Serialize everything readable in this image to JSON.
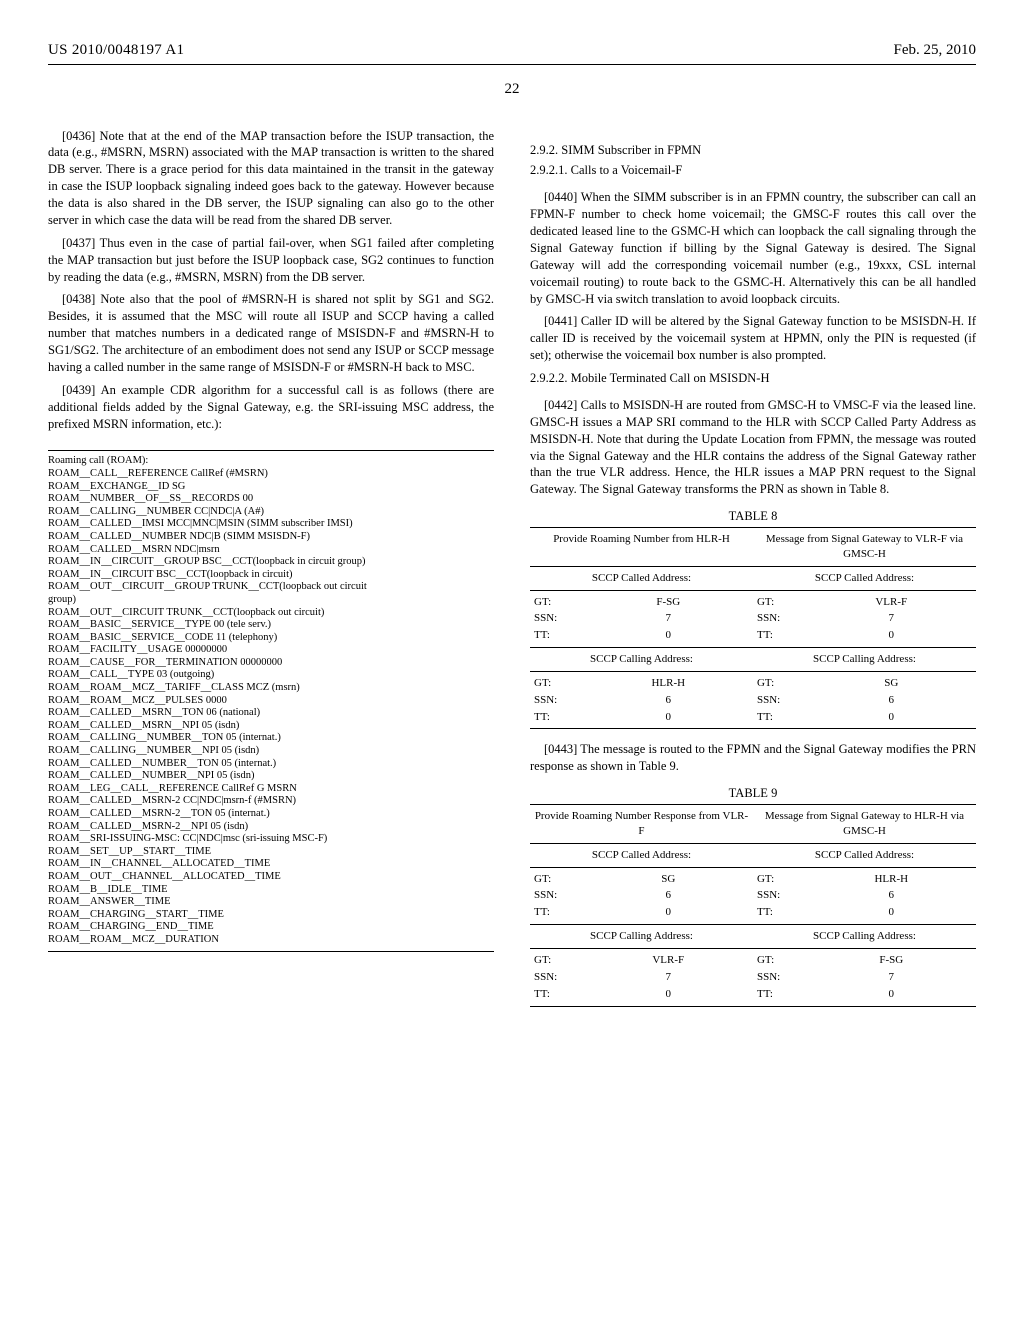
{
  "header": {
    "pubnum": "US 2010/0048197 A1",
    "date": "Feb. 25, 2010",
    "pagenum": "22"
  },
  "left": {
    "p0436": "[0436]   Note that at the end of the MAP transaction before the ISUP transaction, the data (e.g., #MSRN, MSRN) associated with the MAP transaction is written to the shared DB server. There is a grace period for this data maintained in the transit in the gateway in case the ISUP loopback signaling indeed goes back to the gateway. However because the data is also shared in the DB server, the ISUP signaling can also go to the other server in which case the data will be read from the shared DB server.",
    "p0437": "[0437]   Thus even in the case of partial fail-over, when SG1 failed after completing the MAP transaction but just before the ISUP loopback case, SG2 continues to function by reading the data (e.g., #MSRN, MSRN) from the DB server.",
    "p0438": "[0438]   Note also that the pool of #MSRN-H is shared not split by SG1 and SG2. Besides, it is assumed that the MSC will route all ISUP and SCCP having a called number that matches numbers in a dedicated range of MSISDN-F and #MSRN-H to SG1/SG2. The architecture of an embodiment does not send any ISUP or SCCP message having a called number in the same range of MSISDN-F or #MSRN-H back to MSC.",
    "p0439": "[0439]   An example CDR algorithm for a successful call is as follows (there are additional fields added by the Signal Gateway, e.g. the SRI-issuing MSC address, the prefixed MSRN information, etc.):",
    "listing": [
      "Roaming call (ROAM):",
      "ROAM__CALL__REFERENCE CallRef (#MSRN)",
      "ROAM__EXCHANGE__ID SG",
      "ROAM__NUMBER__OF__SS__RECORDS 00",
      "ROAM__CALLING__NUMBER CC|NDC|A (A#)",
      "ROAM__CALLED__IMSI MCC|MNC|MSIN (SIMM subscriber IMSI)",
      "ROAM__CALLED__NUMBER NDC|B (SIMM MSISDN-F)",
      "ROAM__CALLED__MSRN NDC|msrn",
      "ROAM__IN__CIRCUIT__GROUP BSC__CCT(loopback in circuit group)",
      "ROAM__IN__CIRCUIT BSC__CCT(loopback in circuit)",
      "ROAM__OUT__CIRCUIT__GROUP TRUNK__CCT(loopback out circuit",
      "group)",
      "ROAM__OUT__CIRCUIT TRUNK__CCT(loopback out circuit)",
      "ROAM__BASIC__SERVICE__TYPE 00 (tele serv.)",
      "ROAM__BASIC__SERVICE__CODE 11 (telephony)",
      "ROAM__FACILITY__USAGE 00000000",
      "ROAM__CAUSE__FOR__TERMINATION 00000000",
      "ROAM__CALL__TYPE 03 (outgoing)",
      "ROAM__ROAM__MCZ__TARIFF__CLASS MCZ (msrn)",
      "ROAM__ROAM__MCZ__PULSES 0000",
      "ROAM__CALLED__MSRN__TON 06 (national)",
      "ROAM__CALLED__MSRN__NPI 05 (isdn)",
      "ROAM__CALLING__NUMBER__TON 05 (internat.)",
      "ROAM__CALLING__NUMBER__NPI 05 (isdn)",
      "ROAM__CALLED__NUMBER__TON 05 (internat.)",
      "ROAM__CALLED__NUMBER__NPI 05 (isdn)",
      "ROAM__LEG__CALL__REFERENCE CallRef G MSRN",
      "ROAM__CALLED__MSRN-2 CC|NDC|msrn-f (#MSRN)",
      "ROAM__CALLED__MSRN-2__TON 05 (internat.)",
      "ROAM__CALLED__MSRN-2__NPI 05 (isdn)",
      "ROAM__SRI-ISSUING-MSC: CC|NDC|msc (sri-issuing MSC-F)",
      "ROAM__SET__UP__START__TIME",
      "ROAM__IN__CHANNEL__ALLOCATED__TIME",
      "ROAM__OUT__CHANNEL__ALLOCATED__TIME",
      "ROAM__B__IDLE__TIME",
      "ROAM__ANSWER__TIME",
      "ROAM__CHARGING__START__TIME",
      "ROAM__CHARGING__END__TIME",
      "ROAM__ROAM__MCZ__DURATION"
    ]
  },
  "right": {
    "s292": "2.9.2. SIMM Subscriber in FPMN",
    "s2921": "2.9.2.1. Calls to a Voicemail-F",
    "p0440": "[0440]   When the SIMM subscriber is in an FPMN country, the subscriber can call an FPMN-F number to check home voicemail; the GMSC-F routes this call over the dedicated leased line to the GSMC-H which can loopback the call signaling through the Signal Gateway function if billing by the Signal Gateway is desired. The Signal Gateway will add the corresponding voicemail number (e.g., 19xxx, CSL internal voicemail routing) to route back to the GSMC-H. Alternatively this can be all handled by GMSC-H via switch translation to avoid loopback circuits.",
    "p0441": "[0441]   Caller ID will be altered by the Signal Gateway function to be MSISDN-H. If caller ID is received by the voicemail system at HPMN, only the PIN is requested (if set); otherwise the voicemail box number is also prompted.",
    "s2922": "2.9.2.2. Mobile Terminated Call on MSISDN-H",
    "p0442": "[0442]   Calls to MSISDN-H are routed from GMSC-H to VMSC-F via the leased line. GMSC-H issues a MAP SRI command to the HLR with SCCP Called Party Address as MSISDN-H. Note that during the Update Location from FPMN, the message was routed via the Signal Gateway and the HLR contains the address of the Signal Gateway rather than the true VLR address. Hence, the HLR issues a MAP PRN request to the Signal Gateway. The Signal Gateway transforms the PRN as shown in Table 8.",
    "t8": {
      "caption": "TABLE 8",
      "lhead": "Provide Roaming Number from HLR-H",
      "rhead": "Message from Signal Gateway to VLR-F via GMSC-H",
      "called_label": "SCCP Called Address:",
      "calling_label": "SCCP Calling Address:",
      "rows_called_l": [
        [
          "GT:",
          "F-SG"
        ],
        [
          "SSN:",
          "7"
        ],
        [
          "TT:",
          "0"
        ]
      ],
      "rows_called_r": [
        [
          "GT:",
          "VLR-F"
        ],
        [
          "SSN:",
          "7"
        ],
        [
          "TT:",
          "0"
        ]
      ],
      "rows_calling_l": [
        [
          "GT:",
          "HLR-H"
        ],
        [
          "SSN:",
          "6"
        ],
        [
          "TT:",
          "0"
        ]
      ],
      "rows_calling_r": [
        [
          "GT:",
          "SG"
        ],
        [
          "SSN:",
          "6"
        ],
        [
          "TT:",
          "0"
        ]
      ]
    },
    "p0443": "[0443]   The message is routed to the FPMN and the Signal Gateway modifies the PRN response as shown in Table 9.",
    "t9": {
      "caption": "TABLE 9",
      "lhead": "Provide Roaming Number Response from VLR-F",
      "rhead": "Message from Signal Gateway to HLR-H via GMSC-H",
      "called_label": "SCCP Called Address:",
      "calling_label": "SCCP Calling Address:",
      "rows_called_l": [
        [
          "GT:",
          "SG"
        ],
        [
          "SSN:",
          "6"
        ],
        [
          "TT:",
          "0"
        ]
      ],
      "rows_called_r": [
        [
          "GT:",
          "HLR-H"
        ],
        [
          "SSN:",
          "6"
        ],
        [
          "TT:",
          "0"
        ]
      ],
      "rows_calling_l": [
        [
          "GT:",
          "VLR-F"
        ],
        [
          "SSN:",
          "7"
        ],
        [
          "TT:",
          "0"
        ]
      ],
      "rows_calling_r": [
        [
          "GT:",
          "F-SG"
        ],
        [
          "SSN:",
          "7"
        ],
        [
          "TT:",
          "0"
        ]
      ]
    }
  }
}
